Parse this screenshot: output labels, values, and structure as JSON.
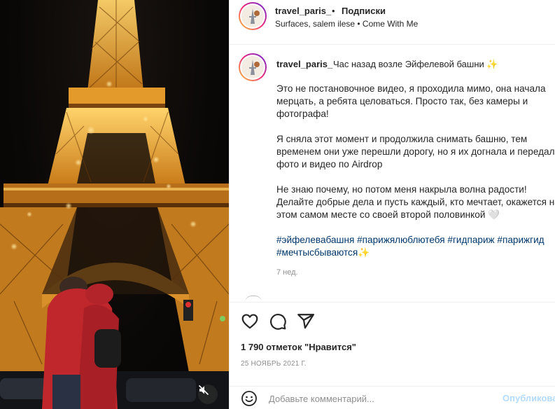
{
  "media": {
    "icons": {
      "mute": "speaker-muted-icon"
    },
    "colors": {
      "tower_light": "#f7b43a",
      "tower_glow": "#ffd36b",
      "sky": "#0a0807",
      "jacket": "#c0272d"
    }
  },
  "header": {
    "username": "travel_paris_",
    "separator": "•",
    "follow_label": "Подписки",
    "audio": "Surfaces, salem ilese • Come With Me"
  },
  "caption": {
    "username": "travel_paris_",
    "first_line": "Час назад возле Эйфелевой башни ✨",
    "paragraphs": [
      [
        "Это не постановочное видео, я проходила мимо, она начала",
        "мерцать, а ребята целоваться. Просто так, без камеры и",
        "фотографа!"
      ],
      [
        "Я сняла этот момент и продолжила снимать башню, тем",
        "временем они уже перешли дорогу, но я их догнала и передала",
        "фото и видео по Airdrop"
      ],
      [
        "Не знаю почему, но потом меня накрыла волна радости!",
        "Делайте добрые дела и пусть каждый, кто мечтает, окажется на",
        "этом самом месте со своей второй половинкой 🤍"
      ]
    ],
    "hashtags": [
      "#эйфелевабашня #парижялюблютебя #гидпариж #парижгид",
      "#мечтысбываются✨"
    ],
    "time_ago": "7 нед."
  },
  "actions": {
    "icons": {
      "like": "heart-icon",
      "comment": "comment-icon",
      "share": "share-icon",
      "emoji": "emoji-icon"
    },
    "likes": "1 790 отметок \"Нравится\"",
    "date": "25 НОЯБРЬ 2021 Г."
  },
  "comment": {
    "placeholder": "Добавьте комментарий...",
    "publish_label": "Опубликовать"
  }
}
